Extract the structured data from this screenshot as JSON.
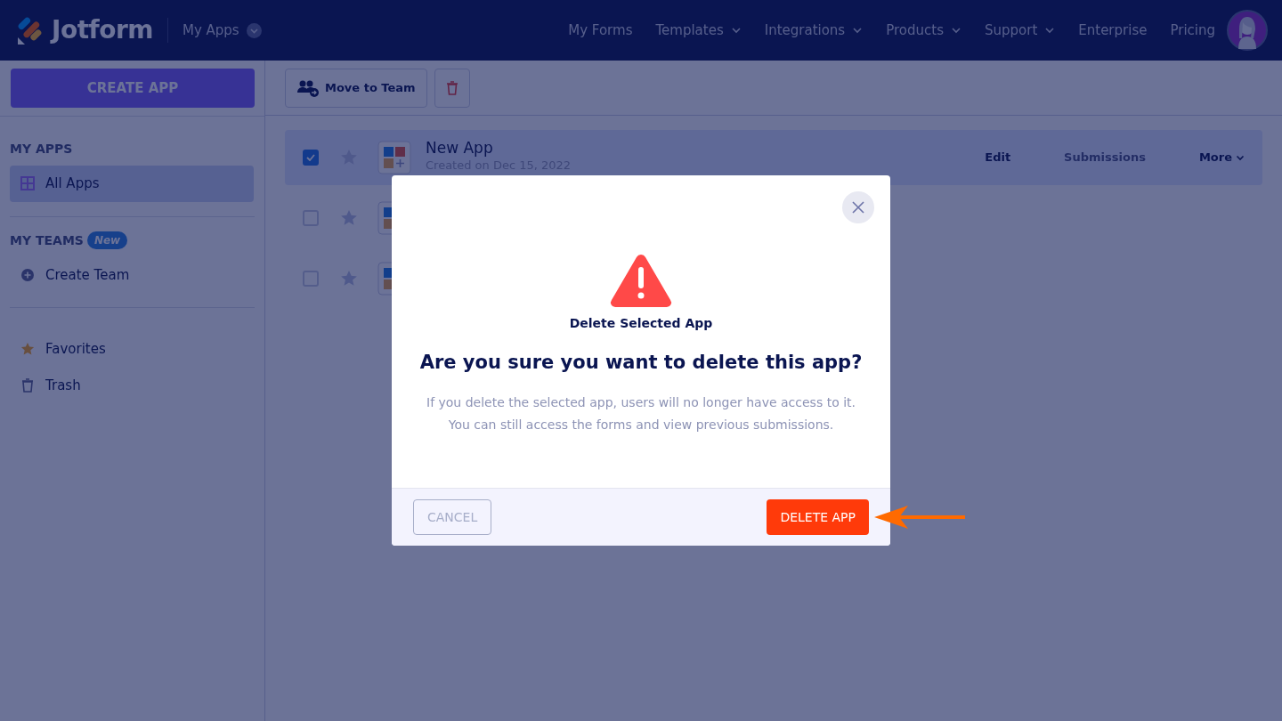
{
  "header": {
    "logo_text": "Jotform",
    "app_menu": "My Apps",
    "nav": [
      {
        "label": "My Forms",
        "dropdown": false
      },
      {
        "label": "Templates",
        "dropdown": true
      },
      {
        "label": "Integrations",
        "dropdown": true
      },
      {
        "label": "Products",
        "dropdown": true
      },
      {
        "label": "Support",
        "dropdown": true
      },
      {
        "label": "Enterprise",
        "dropdown": false
      },
      {
        "label": "Pricing",
        "dropdown": false
      }
    ]
  },
  "sidebar": {
    "create_button": "CREATE APP",
    "sections": [
      {
        "heading": "MY APPS",
        "items": [
          {
            "kind": "apps",
            "label": "All Apps",
            "selected": true
          }
        ]
      },
      {
        "heading": "MY TEAMS",
        "badge": "New",
        "items": [
          {
            "kind": "add",
            "label": "Create Team",
            "selected": false
          }
        ]
      },
      {
        "items": [
          {
            "kind": "star",
            "label": "Favorites",
            "selected": false
          },
          {
            "kind": "trash",
            "label": "Trash",
            "selected": false
          }
        ]
      }
    ]
  },
  "toolbar": {
    "move_button": "Move to Team"
  },
  "apps": [
    {
      "name": "New App",
      "subtitle": "Created on Dec 15, 2022",
      "checked": true,
      "actions": [
        "Edit",
        "Submissions",
        "More"
      ]
    },
    {
      "checked": false
    },
    {
      "checked": false
    }
  ],
  "modal": {
    "eyebrow": "Delete Selected App",
    "title": "Are you sure you want to delete this app?",
    "message": [
      "If you delete the selected app, users will no longer have access to it.",
      "You can still access the forms and view previous submissions."
    ],
    "cancel": "CANCEL",
    "confirm": "DELETE APP"
  }
}
